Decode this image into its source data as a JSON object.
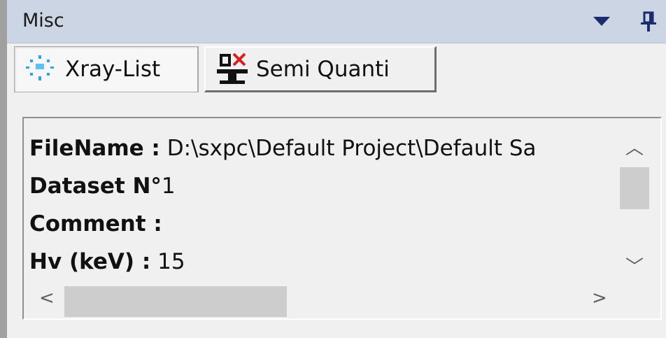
{
  "window": {
    "title": "Misc"
  },
  "tabs": [
    {
      "label": "Xray-List",
      "icon": "xray-icon",
      "selected": true
    },
    {
      "label": "Semi Quanti",
      "icon": "semi-quanti-icon",
      "selected": false
    }
  ],
  "info": {
    "filename_label": "FileName :",
    "filename_value": "D:\\sxpc\\Default Project\\Default Sa",
    "dataset_label": "Dataset N°",
    "dataset_value": "1",
    "comment_label": "Comment :",
    "comment_value": "",
    "hv_label": "Hv (keV) :",
    "hv_value": "15"
  },
  "colors": {
    "title_bar": "#ccd5e3",
    "dropdown_arrow": "#1c2a6e",
    "panel_bg": "#f0f0f0",
    "scroll_thumb": "#cdcdcd"
  }
}
